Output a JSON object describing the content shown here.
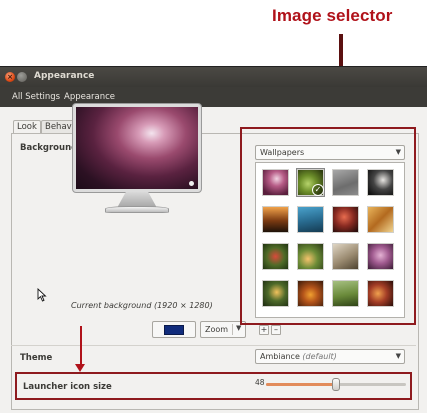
{
  "annotation": {
    "title": "Image selector",
    "arrow_color": "#5b1010",
    "title_color": "#b0121a"
  },
  "window": {
    "title": "Appearance",
    "close_glyph": "×"
  },
  "menubar": {
    "all_settings": "All Settings",
    "appearance": "Appearance"
  },
  "tabs": [
    {
      "label": "Look",
      "active": true
    },
    {
      "label": "Behavior",
      "active": false
    }
  ],
  "background": {
    "section_label": "Background",
    "caption": "Current background (1920 × 1280)",
    "selected_color": "#112c7c",
    "zoom_label": "Zoom"
  },
  "wallpapers": {
    "source": "Wallpapers",
    "add_label": "+",
    "remove_label": "–",
    "thumbnails": [
      {
        "name": "wallpaper-1",
        "bg": "radial-gradient(circle at 55% 35%, #f1d3e2, #b65b86 35%, #5a1f3d 80%)"
      },
      {
        "name": "wallpaper-2",
        "bg": "radial-gradient(circle at 40% 55%, #b6d36b, #6d8f2a 40%, #2f3d10 90%)",
        "selected": true
      },
      {
        "name": "wallpaper-3",
        "bg": "linear-gradient(160deg, #a8a8a8, #6d6d6d 60%, #8c8c8c)"
      },
      {
        "name": "wallpaper-4",
        "bg": "radial-gradient(circle at 60% 40%, #e8e6e2, #444 45%, #111 90%)"
      },
      {
        "name": "wallpaper-5",
        "bg": "linear-gradient(180deg, #f1a24a, #7b3a12 55%, #1f1209)"
      },
      {
        "name": "wallpaper-6",
        "bg": "linear-gradient(170deg, #4aa2cc, #2a6e93 50%, #153b52)"
      },
      {
        "name": "wallpaper-7",
        "bg": "radial-gradient(circle at 45% 40%, #e86c4f, #8a2b22 45%, #2d0f0d 90%)"
      },
      {
        "name": "wallpaper-8",
        "bg": "linear-gradient(135deg, #e9b55c, #b36a1f 50%, #f0d490)"
      },
      {
        "name": "wallpaper-9",
        "bg": "radial-gradient(circle at 50% 50%, #d94a3b, #4f6b27 50%, #203311)"
      },
      {
        "name": "wallpaper-10",
        "bg": "radial-gradient(circle at 40% 60%, #f5c36c, #6b8b36 45%, #2a3a16)"
      },
      {
        "name": "wallpaper-11",
        "bg": "linear-gradient(150deg, #e0d6c4, #9a8a70 55%, #4e4330)"
      },
      {
        "name": "wallpaper-12",
        "bg": "radial-gradient(circle at 50% 45%, #e4b2d4, #a05a8f 45%, #3a1b35)"
      },
      {
        "name": "wallpaper-13",
        "bg": "radial-gradient(circle at 55% 45%, #f2c25c, #4e6a2a 45%, #1b2a10)"
      },
      {
        "name": "wallpaper-14",
        "bg": "radial-gradient(circle at 50% 55%, #f0a030, #b4541a 40%, #3a1a0a)"
      },
      {
        "name": "wallpaper-15",
        "bg": "linear-gradient(170deg, #a6c081, #6a8a3a 55%, #2f4317)"
      },
      {
        "name": "wallpaper-16",
        "bg": "radial-gradient(circle at 40% 50%, #f0a04e, #a33d26 45%, #2a0c08)"
      }
    ]
  },
  "theme": {
    "section_label": "Theme",
    "value": "Ambiance",
    "qualifier": "(default)"
  },
  "launcher": {
    "label": "Launcher icon size",
    "value": "48",
    "min": 32,
    "max": 64,
    "accent": "#e28b5a"
  }
}
